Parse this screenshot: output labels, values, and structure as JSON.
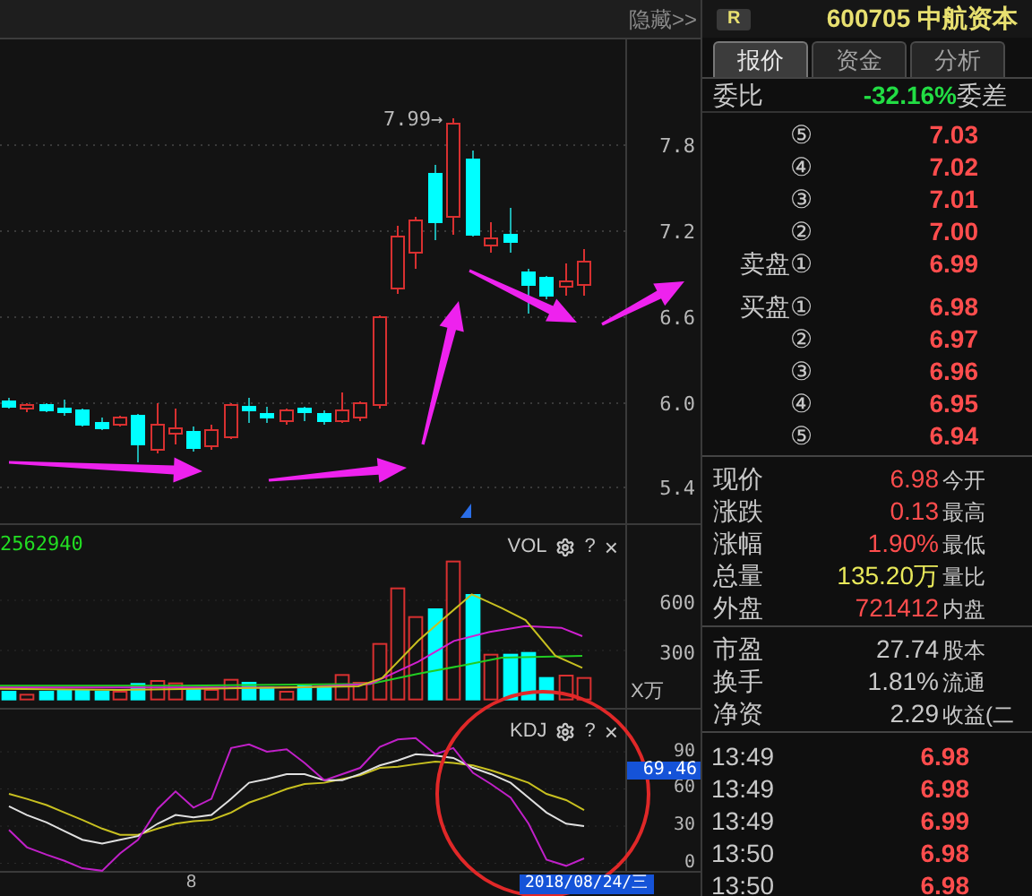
{
  "chart_panel": {
    "hide_button": "隐藏>>",
    "high_label": "7.99→",
    "price_axis": [
      "7.8",
      "7.2",
      "6.6",
      "6.0",
      "5.4"
    ]
  },
  "volume_panel": {
    "value": "2562940",
    "title": "VOL",
    "help": "?",
    "close": "×",
    "axis": [
      "600",
      "300"
    ],
    "unit": "X万"
  },
  "kdj_panel": {
    "title": "KDJ",
    "help": "?",
    "close": "×",
    "current_value": "69.46",
    "chart_data": {
      "type": "line",
      "ylim": [
        -9,
        124
      ],
      "yticks": [
        0,
        30,
        60,
        90
      ],
      "grid": true,
      "series": [
        {
          "color": "#c8c020",
          "values": [
            56,
            52,
            47,
            41,
            35,
            28,
            23,
            23,
            28,
            32,
            34,
            35,
            41,
            49,
            54,
            60,
            64,
            65,
            68,
            71,
            77,
            78,
            80,
            82,
            81,
            79,
            75,
            70,
            65,
            56,
            51,
            43
          ]
        },
        {
          "color": "#e0e0e0",
          "values": [
            46,
            39,
            33,
            26,
            19,
            16,
            19,
            22,
            32,
            39,
            37,
            39,
            52,
            65,
            68,
            72,
            72,
            67,
            67,
            72,
            79,
            83,
            88,
            87,
            85,
            77,
            72,
            65,
            53,
            41,
            32,
            30
          ]
        },
        {
          "color": "#c020c8",
          "values": [
            27,
            13,
            7,
            2,
            -4,
            -6,
            8,
            19,
            44,
            58,
            45,
            52,
            93,
            96,
            90,
            92,
            81,
            67,
            72,
            77,
            94,
            100,
            101,
            88,
            93,
            73,
            64,
            53,
            32,
            3,
            -2,
            4
          ]
        }
      ]
    }
  },
  "x_axis": {
    "label": "8",
    "cursor_date": "2018/08/24/三"
  },
  "quote": {
    "badge": "R",
    "code": "600705",
    "name": "中航资本",
    "tabs": [
      {
        "label": "报价",
        "selected": true
      },
      {
        "label": "资金",
        "selected": false
      },
      {
        "label": "分析",
        "selected": false
      }
    ],
    "ratio": {
      "label": "委比",
      "value": "-32.16%",
      "color": "#22dd44",
      "diff_label": "委差"
    },
    "asks": [
      {
        "rank": "⑤",
        "price": "7.03"
      },
      {
        "rank": "④",
        "price": "7.02"
      },
      {
        "rank": "③",
        "price": "7.01"
      },
      {
        "rank": "②",
        "price": "7.00"
      },
      {
        "side": "卖盘",
        "rank": "①",
        "price": "6.99"
      }
    ],
    "bids": [
      {
        "side": "买盘",
        "rank": "①",
        "price": "6.98"
      },
      {
        "rank": "②",
        "price": "6.97"
      },
      {
        "rank": "③",
        "price": "6.96"
      },
      {
        "rank": "④",
        "price": "6.95"
      },
      {
        "rank": "⑤",
        "price": "6.94"
      }
    ],
    "trade_stats": [
      {
        "label": "现价",
        "value": "6.98",
        "color": "#ff4d4d",
        "label2": "今开"
      },
      {
        "label": "涨跌",
        "value": "0.13",
        "color": "#ff4d4d",
        "label2": "最高"
      },
      {
        "label": "涨幅",
        "value": "1.90%",
        "color": "#ff4d4d",
        "label2": "最低"
      },
      {
        "label": "总量",
        "value": "135.20万",
        "color": "#e8e85a",
        "label2": "量比"
      },
      {
        "label": "外盘",
        "value": "721412",
        "color": "#ff4d4d",
        "label2": "内盘"
      }
    ],
    "fundamentals": [
      {
        "label": "市盈",
        "value": "27.74",
        "color": "#c8c8c8",
        "label2": "股本"
      },
      {
        "label": "换手",
        "value": "1.81%",
        "color": "#c8c8c8",
        "label2": "流通"
      },
      {
        "label": "净资",
        "value": "2.29",
        "color": "#c8c8c8",
        "label2": "收益(二"
      }
    ],
    "ticks": [
      {
        "time": "13:49",
        "price": "6.98"
      },
      {
        "time": "13:49",
        "price": "6.98"
      },
      {
        "time": "13:49",
        "price": "6.99"
      },
      {
        "time": "13:50",
        "price": "6.98"
      },
      {
        "time": "13:50",
        "price": "6.98"
      }
    ]
  }
}
